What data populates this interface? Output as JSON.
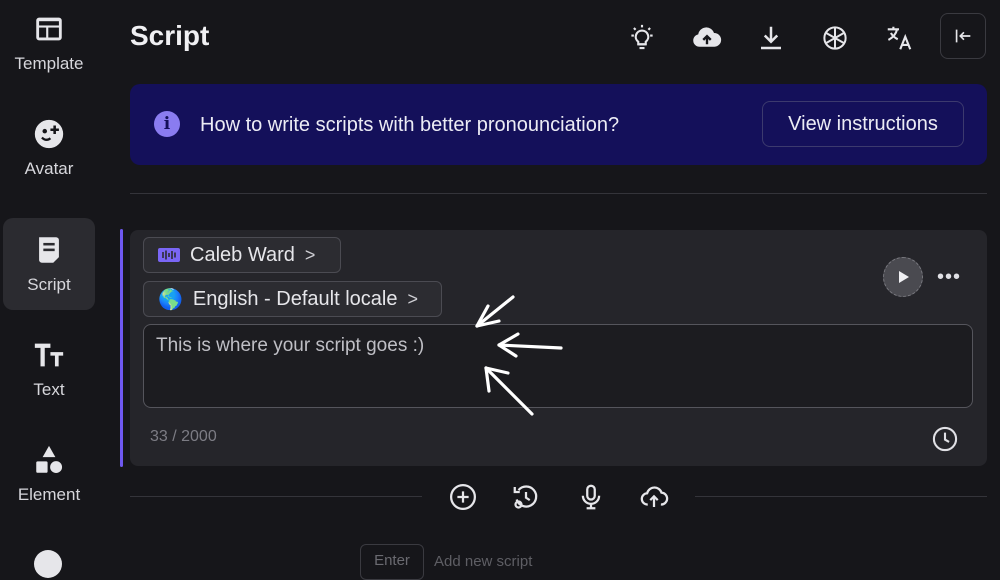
{
  "sidebar": {
    "items": [
      {
        "label": "Template",
        "icon": "template-icon"
      },
      {
        "label": "Avatar",
        "icon": "avatar-icon"
      },
      {
        "label": "Script",
        "icon": "script-icon",
        "active": true
      },
      {
        "label": "Text",
        "icon": "text-icon"
      },
      {
        "label": "Element",
        "icon": "element-icon"
      }
    ]
  },
  "header": {
    "title": "Script",
    "icons": [
      "lightbulb-icon",
      "cloud-upload-icon",
      "download-icon",
      "openai-icon",
      "translate-icon",
      "collapse-panel-icon"
    ]
  },
  "banner": {
    "text": "How to write scripts with better pronounciation?",
    "button_label": "View instructions",
    "icon": "info-icon"
  },
  "script_card": {
    "voice_label": "Caleb Ward",
    "language_flag": "🌎",
    "language_label": "English - Default locale",
    "chevron": ">",
    "text": "This is where your script goes :)",
    "char_count": "33 / 2000",
    "more_label": "•••"
  },
  "toolbar": {
    "icons": [
      "add-icon",
      "history-icon",
      "microphone-icon",
      "upload-audio-icon"
    ]
  },
  "footer": {
    "enter_key": "Enter",
    "add_hint": "Add new script"
  },
  "colors": {
    "background": "#16161a",
    "banner": "#14105a",
    "accent": "#6e58f0",
    "card": "#25252a"
  }
}
